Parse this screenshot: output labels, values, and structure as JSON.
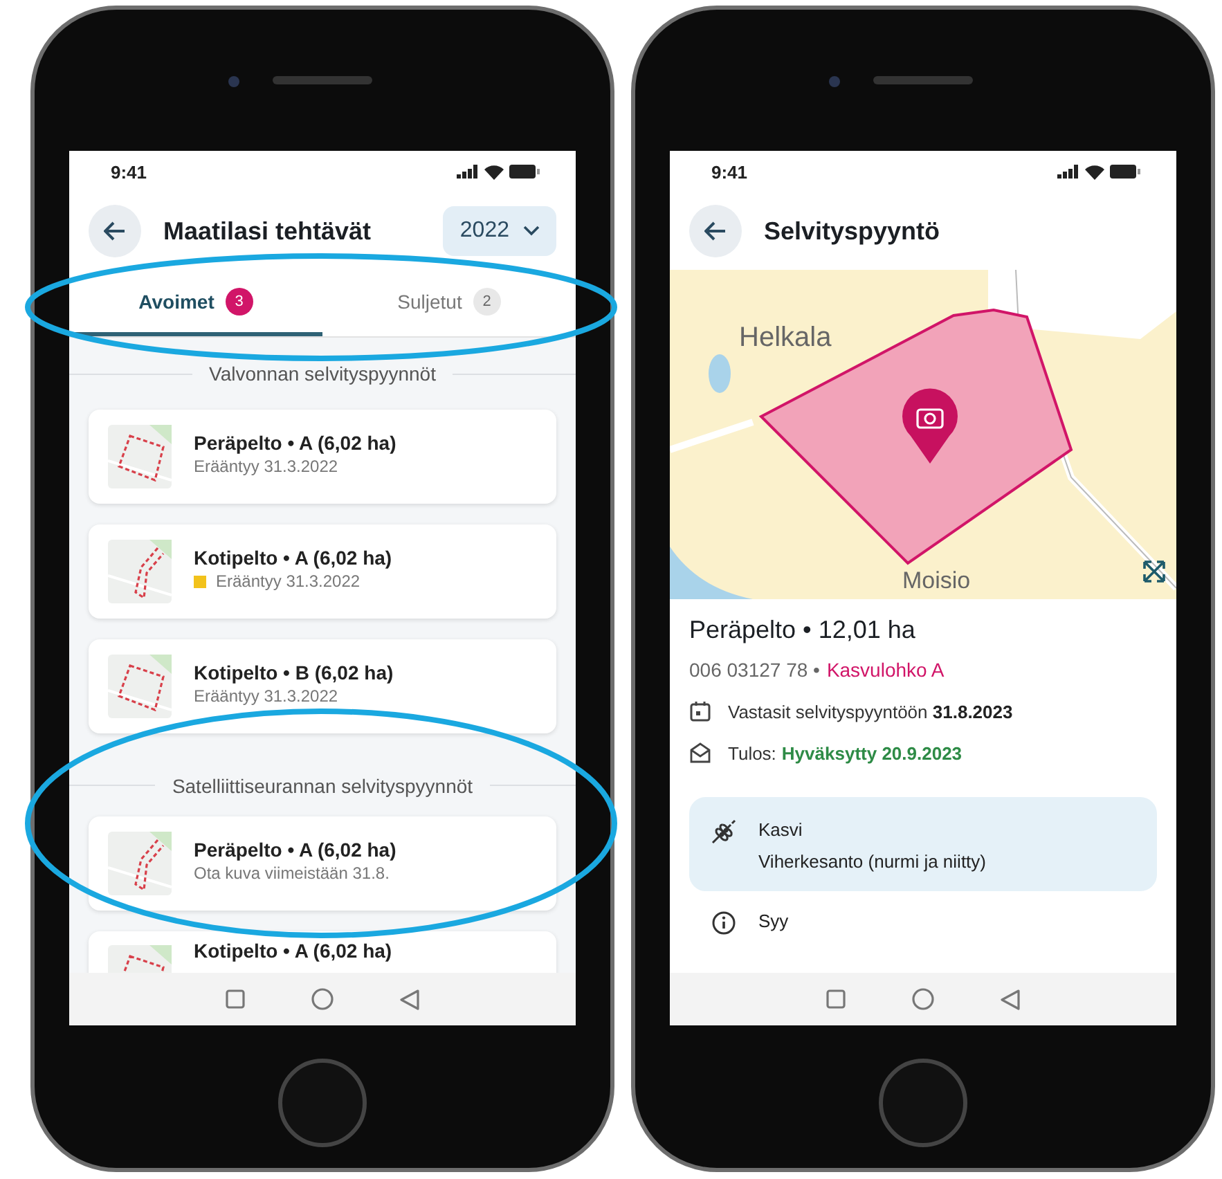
{
  "left_screen": {
    "status_bar": {
      "time": "9:41"
    },
    "header": {
      "title": "Maatilasi tehtävät",
      "year": "2022"
    },
    "tabs": [
      {
        "label": "Avoimet",
        "count": "3",
        "selected": true
      },
      {
        "label": "Suljetut",
        "count": "2",
        "selected": false
      }
    ],
    "sections": [
      {
        "title": "Valvonnan selvityspyynnöt",
        "items": [
          {
            "title": "Peräpelto • A (6,02 ha)",
            "subtitle": "Erääntyy 31.3.2022",
            "flagged": false
          },
          {
            "title": "Kotipelto • A (6,02 ha)",
            "subtitle": "Erääntyy 31.3.2022",
            "flagged": true
          },
          {
            "title": "Kotipelto • B (6,02 ha)",
            "subtitle": "Erääntyy 31.3.2022",
            "flagged": false
          }
        ]
      },
      {
        "title": "Satelliittiseurannan selvityspyynnöt",
        "items": [
          {
            "title": "Peräpelto • A (6,02 ha)",
            "subtitle": "Ota kuva viimeistään 31.8.",
            "flagged": false
          },
          {
            "title": "Kotipelto • A (6,02 ha)"
          }
        ]
      }
    ]
  },
  "right_screen": {
    "status_bar": {
      "time": "9:41"
    },
    "header": {
      "title": "Selvityspyyntö"
    },
    "map": {
      "labels": [
        "Helkala",
        "Moisio"
      ]
    },
    "parcel": {
      "title": "Peräpelto • 12,01 ha",
      "id": "006 03127 78 •",
      "block": "Kasvulohko A"
    },
    "events": [
      {
        "kind": "calendar",
        "text": "Vastasit selvityspyyntöön **31.8.2023**"
      },
      {
        "kind": "result",
        "label": "Tulos:",
        "value": "Hyväksytty 20.9.2023"
      }
    ],
    "details": [
      {
        "kind": "crop",
        "label": "Kasvi",
        "value": "Viherkesanto (nurmi ja niitty)"
      },
      {
        "kind": "info",
        "label": "Syy"
      }
    ]
  }
}
